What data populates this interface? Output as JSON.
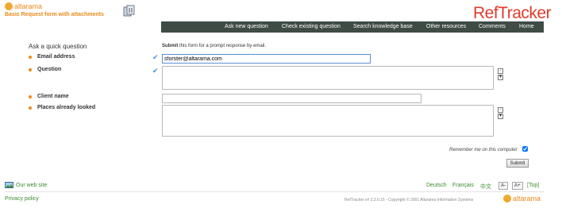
{
  "header": {
    "brand": "altarama",
    "form_title": "Basic Request form with attachments",
    "product_name": "RefTracker"
  },
  "nav": {
    "items": [
      "Ask new question",
      "Check existing question",
      "Search knowledge base",
      "Other resources",
      "Comments",
      "Home"
    ]
  },
  "form": {
    "heading": "Ask a quick question",
    "intro_bold": "Submit",
    "intro_rest": " this form for a prompt response by email.",
    "email_label": "Email address",
    "email_value": "sforster@altarama.com",
    "question_label": "Question",
    "question_value": "",
    "client_label": "Client name",
    "client_value": "",
    "places_label": "Places already looked",
    "places_value": "",
    "remember_label": "Remember me on this computer",
    "remember_checked": true,
    "submit_label": "Submit"
  },
  "footer": {
    "web_site": "Our web site",
    "privacy": "Privacy policy",
    "lang_de": "Deutsch",
    "lang_fr": "Français",
    "lang_zh": "中文",
    "text_smaller": "A-",
    "text_larger": "A+",
    "top": "[Top]",
    "copyright": "RefTracker v# 3.3.0.15 - Copyright © 2001 Altarama Information Systems",
    "brand": "altarama"
  },
  "colors": {
    "brand_orange": "#e98a1a",
    "nav_bg": "#3f4b45",
    "link_green": "#3d8b2f",
    "check_blue": "#4a90d9"
  }
}
